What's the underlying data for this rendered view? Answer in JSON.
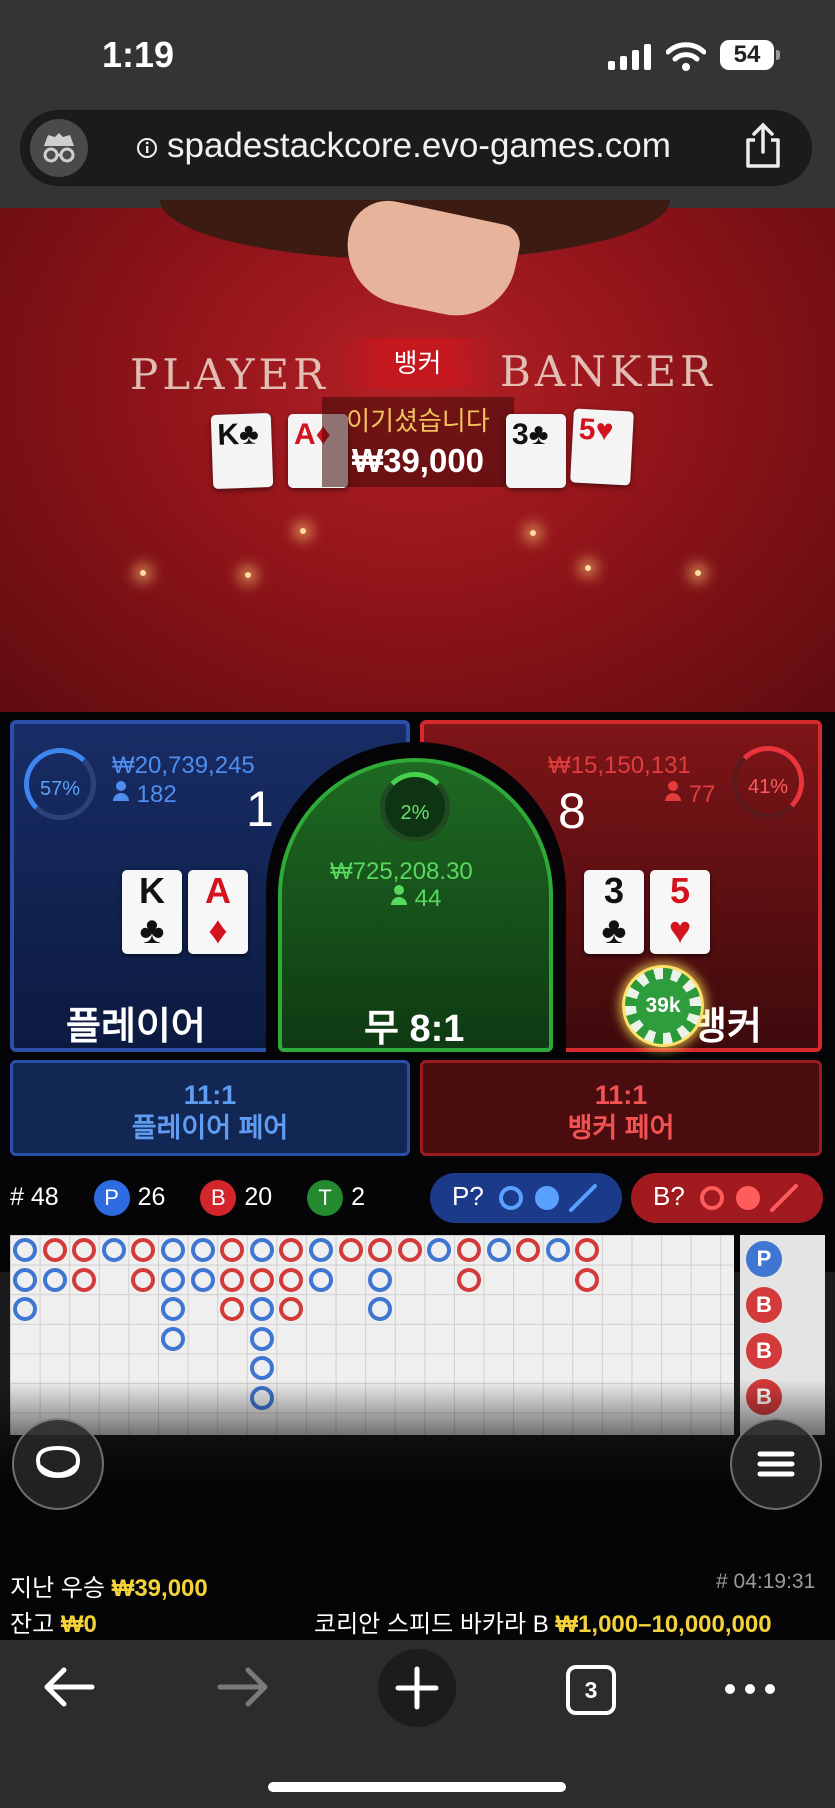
{
  "status_bar": {
    "time": "1:19",
    "battery": "54"
  },
  "browser": {
    "url": "spadestackcore.evo-games.com",
    "tab_count": "3"
  },
  "table": {
    "player_label": "PLAYER",
    "banker_label": "BANKER",
    "winner_label": "뱅커",
    "win_message": "이기셨습니다",
    "win_amount": "₩39,000",
    "player_cards": [
      {
        "rank": "K",
        "suit": "♣"
      },
      {
        "rank": "A",
        "suit": "♦"
      }
    ],
    "banker_cards": [
      {
        "rank": "3",
        "suit": "♣"
      },
      {
        "rank": "5",
        "suit": "♥"
      }
    ]
  },
  "bets": {
    "player": {
      "percent": "57%",
      "amount": "₩20,739,245",
      "players": "182",
      "score": "1",
      "name": "플레이어",
      "cards": [
        {
          "rank": "K",
          "suit": "♣"
        },
        {
          "rank": "A",
          "suit": "♦"
        }
      ]
    },
    "tie": {
      "percent": "2%",
      "amount": "₩725,208.30",
      "players": "44",
      "name": "무 8:1"
    },
    "banker": {
      "percent": "41%",
      "amount": "₩15,150,131",
      "players": "77",
      "score": "8",
      "name": "뱅커",
      "cards": [
        {
          "rank": "3",
          "suit": "♣"
        },
        {
          "rank": "5",
          "suit": "♥"
        }
      ]
    },
    "chip": "39k",
    "player_pair": {
      "odds": "11:1",
      "label": "플레이어 페어"
    },
    "banker_pair": {
      "odds": "11:1",
      "label": "뱅커 페어"
    }
  },
  "stats": {
    "rounds_label": "#",
    "rounds": "48",
    "p_label": "P",
    "p_count": "26",
    "b_label": "B",
    "b_count": "20",
    "t_label": "T",
    "t_count": "2",
    "player_predict": "P?",
    "banker_predict": "B?"
  },
  "footer": {
    "last_win_label": "지난 우승",
    "last_win": "₩39,000",
    "balance_label": "잔고",
    "balance": "₩0",
    "round_id": "# 04:19:31",
    "table_name": "코리안 스피드 바카라 B",
    "limits": "₩1,000–10,000,000"
  },
  "colors": {
    "player": "#2a4fa8",
    "banker": "#d42a2e",
    "tie": "#2eaa39",
    "gold": "#f4d23a"
  }
}
